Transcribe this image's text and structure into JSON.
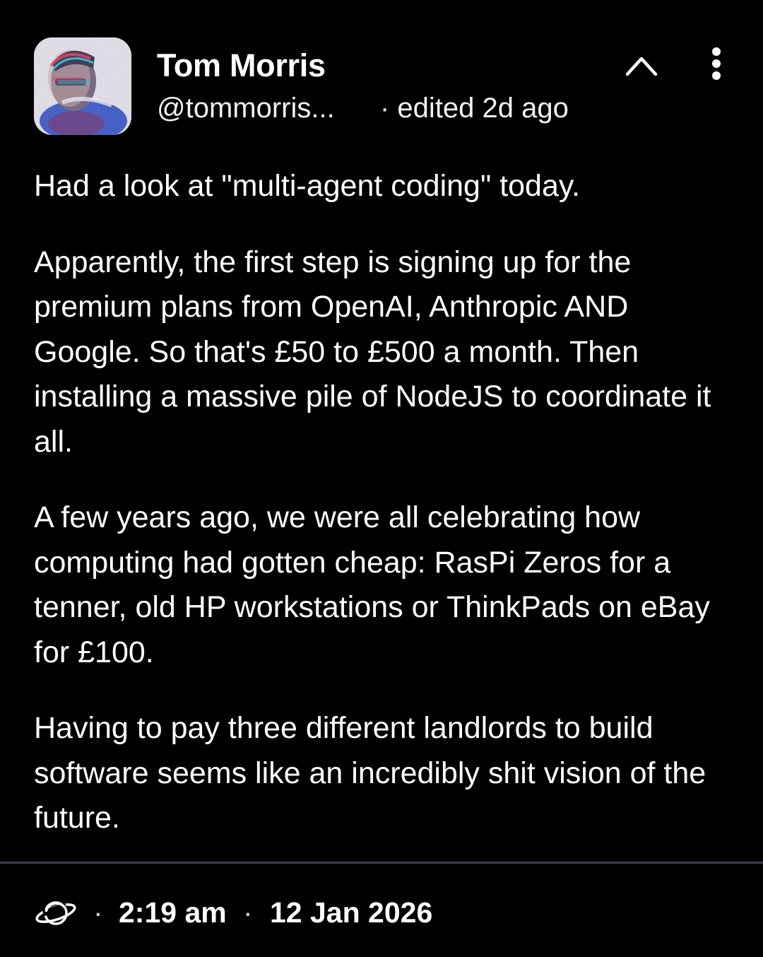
{
  "author": {
    "name": "Tom Morris",
    "handle": "@tommorris...",
    "edited": "· edited 2d ago"
  },
  "post": {
    "paragraphs": [
      "Had a look at \"multi-agent coding\" today.",
      "Apparently, the first step is signing up for the premium plans from OpenAI, Anthropic AND Google. So that's £50 to £500 a month. Then installing a massive pile of NodeJS to coordinate it all.",
      "A few years ago, we were all celebrating how computing had gotten cheap: RasPi Zeros for a tenner, old HP workstations or ThinkPads on eBay for £100.",
      "Having to pay three different landlords to build software seems like an incredibly shit vision of the future."
    ]
  },
  "footer": {
    "visibility_icon": "planet-icon",
    "separator": "·",
    "time": "2:19 am",
    "date": "12 Jan 2026"
  },
  "colors": {
    "background": "#000000",
    "text": "#ffffff",
    "divider": "#3a3f4a"
  }
}
